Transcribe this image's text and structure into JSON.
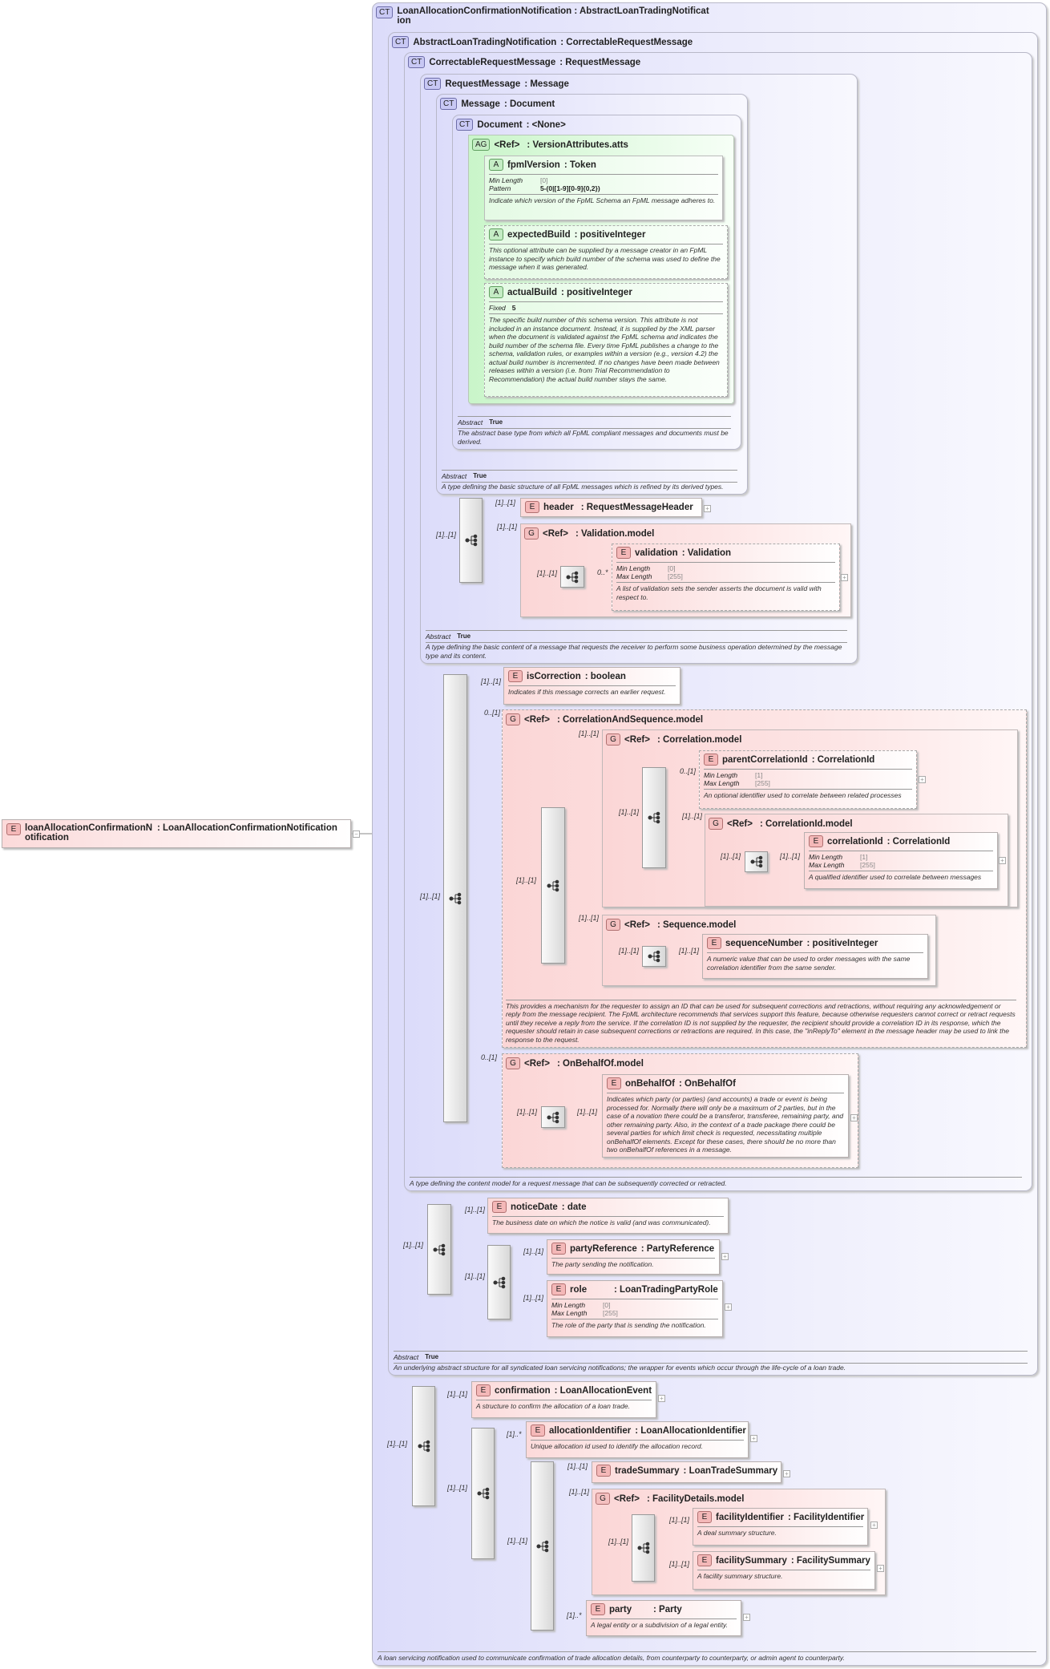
{
  "badges": {
    "ct": "CT",
    "e": "E",
    "g": "G",
    "ag": "AG",
    "a": "A",
    "ref": "<Ref>"
  },
  "root": {
    "name": "loanAllocationConfirmationNotification",
    "type": ": LoanAllocationConfirmationNotification"
  },
  "types": {
    "loanAlloc": {
      "name": "LoanAllocationConfirmationNotification",
      "type": ": AbstractLoanTradingNotification",
      "desc": "A loan servicing notification used to communicate confirmation of trade allocation details, from counterparty to counterparty, or admin agent to counterparty."
    },
    "abstractLoan": {
      "name": "AbstractLoanTradingNotification",
      "type": ": CorrectableRequestMessage",
      "abstract_label": "Abstract",
      "abstract_value": "True",
      "desc": "An underlying abstract structure for all syndicated loan servicing notifications; the wrapper for events which occur through the life-cycle of a loan trade."
    },
    "correctable": {
      "name": "CorrectableRequestMessage",
      "type": ": RequestMessage",
      "desc": "A type defining the content model for a request message that can be subsequently corrected or retracted."
    },
    "request": {
      "name": "RequestMessage",
      "type": ": Message",
      "abstract_label": "Abstract",
      "abstract_value": "True",
      "desc": "A type defining the basic content of a message that requests the receiver to perform some business operation determined by the message type and its content."
    },
    "message": {
      "name": "Message",
      "type": ": Document",
      "abstract_label": "Abstract",
      "abstract_value": "True",
      "desc": "A type defining the basic structure of all FpML messages which is refined by its derived types."
    },
    "document": {
      "name": "Document",
      "type": ": <None>",
      "abstract_label": "Abstract",
      "abstract_value": "True",
      "desc": "The abstract base type from which all FpML compliant messages and documents must be derived."
    }
  },
  "version_atts": {
    "type": ": VersionAttributes.atts",
    "fpmlVersion": {
      "name": "fpmlVersion",
      "type": ": Token",
      "min_label": "Min Length",
      "min": "[0]",
      "pattern_label": "Pattern",
      "pattern": "5-(0|[1-9][0-9]{0,2})",
      "desc": "Indicate which version of the FpML Schema an FpML message adheres to."
    },
    "expectedBuild": {
      "name": "expectedBuild",
      "type": ": positiveInteger",
      "desc": "This optional attribute can be supplied by a message creator in an FpML instance to specify which build number of the schema was used to define the message when it was generated."
    },
    "actualBuild": {
      "name": "actualBuild",
      "type": ": positiveInteger",
      "fixed_label": "Fixed",
      "fixed": "5",
      "desc": "The specific build number of this schema version. This attribute is not included in an instance document. Instead, it is supplied by the XML parser when the document is validated against the FpML schema and indicates the build number of the schema file. Every time FpML publishes a change to the schema, validation rules, or examples within a version (e.g., version 4.2) the actual build number is incremented. If no changes have been made between releases within a version (i.e. from Trial Recommendation to Recommendation) the actual build number stays the same."
    }
  },
  "header": {
    "name": "header",
    "type": ": RequestMessageHeader",
    "card": "[1]..[1]"
  },
  "validation_model": {
    "type": ": Validation.model",
    "card": "[1]..[1]",
    "seq_card": "[1]..[1]",
    "inner_card": "0..*"
  },
  "validation": {
    "name": "validation",
    "type": ": Validation",
    "min_label": "Min Length",
    "min": "[0]",
    "max_label": "Max Length",
    "max": "[255]",
    "desc": "A list of validation sets the sender asserts the document is valid with respect to."
  },
  "request_seq_card": "[1]..[1]",
  "isCorrection": {
    "name": "isCorrection",
    "type": ": boolean",
    "card": "[1]..[1]",
    "desc": "Indicates if this message corrects an earlier request."
  },
  "corr_seq": {
    "type": ": CorrelationAndSequence.model",
    "card": "0..[1]",
    "seq_card": "[1]..[1]",
    "desc": "This provides a mechanism for the requester to assign an ID that can be used for subsequent corrections and retractions, without requiring any acknowledgement or reply from the message recipient. The FpML architecture recommends that services support this feature, because otherwise requesters cannot correct or retract requests until they receive a reply from the service. If the correlation ID is not supplied by the requester, the recipient should provide a correlation ID in its response, which the requester should retain in case subsequent corrections or retractions are required. In this case, the \"inReplyTo\" element in the message header may be used to link the response to the request."
  },
  "correlation_model": {
    "type": ": Correlation.model",
    "card": "[1]..[1]",
    "seq_card": "[1]..[1]"
  },
  "parentCorrelationId": {
    "name": "parentCorrelationId",
    "type": ": CorrelationId",
    "card": "0..[1]",
    "min_label": "Min Length",
    "min": "[1]",
    "max_label": "Max Length",
    "max": "[255]",
    "desc": "An optional identifier used to correlate between related processes"
  },
  "correlationId_model": {
    "type": ": CorrelationId.model",
    "card": "[1]..[1]",
    "seq_card": "[1]..[1]"
  },
  "correlationId": {
    "name": "correlationId",
    "type": ": CorrelationId",
    "card": "[1]..[1]",
    "min_label": "Min Length",
    "min": "[1]",
    "max_label": "Max Length",
    "max": "[255]",
    "desc": "A qualified identifier used to correlate between messages"
  },
  "sequence_model": {
    "type": ": Sequence.model",
    "card": "[1]..[1]",
    "seq_card": "[1]..[1]"
  },
  "sequenceNumber": {
    "name": "sequenceNumber",
    "type": ": positiveInteger",
    "card": "[1]..[1]",
    "desc": "A numeric value that can be used to order messages with the same correlation identifier from the same sender."
  },
  "onBehalf_model": {
    "type": ": OnBehalfOf.model",
    "card": "0..[1]",
    "seq_card": "[1]..[1]"
  },
  "onBehalfOf": {
    "name": "onBehalfOf",
    "type": ": OnBehalfOf",
    "card": "[1]..[1]",
    "desc": "Indicates which party (or parties) (and accounts) a trade or event is being processed for. Normally there will only be a maximum of 2 parties, but in the case of a novation there could be a transferor, transferee, remaining party, and other remaining party. Also, in the context of a trade package there could be several parties for which limit check is requested, necessitating multiple onBehalfOf elements. Except for these cases, there should be no more than two onBehalfOf references in a message."
  },
  "correctable_seq_card": "[1]..[1]",
  "noticeDate": {
    "name": "noticeDate",
    "type": ": date",
    "card": "[1]..[1]",
    "desc": "The business date on which the notice is valid (and was communicated)."
  },
  "party_seq_card": "[1]..[1]",
  "partyReference": {
    "name": "partyReference",
    "type": ": PartyReference",
    "card": "[1]..[1]",
    "desc": "The party sending the notification."
  },
  "role": {
    "name": "role",
    "type": ": LoanTradingPartyRole",
    "card": "[1]..[1]",
    "min_label": "Min Length",
    "min": "[0]",
    "max_label": "Max Length",
    "max": "[255]",
    "desc": "The role of the party that is sending the notification."
  },
  "abstract_seq_card": "[1]..[1]",
  "outer_seq_card": "[1]..[1]",
  "confirmation": {
    "name": "confirmation",
    "type": ": LoanAllocationEvent",
    "card": "[1]..[1]",
    "desc": "A structure to confirm the allocation of a loan trade."
  },
  "seq2_card": "[1]..[1]",
  "allocationIdentifier": {
    "name": "allocationIdentifier",
    "type": ": LoanAllocationIdentifier",
    "card": "[1]..*",
    "desc": "Unique allocation id used to identify the allocation record."
  },
  "seq3_card": "[1]..[1]",
  "tradeSummary": {
    "name": "tradeSummary",
    "type": ": LoanTradeSummary",
    "card": "[1]..[1]"
  },
  "facility_model": {
    "type": ": FacilityDetails.model",
    "card": "[1]..[1]",
    "seq_card": "[1]..[1]"
  },
  "facilityIdentifier": {
    "name": "facilityIdentifier",
    "type": ": FacilityIdentifier",
    "card": "[1]..[1]",
    "desc": "A deal summary structure."
  },
  "facilitySummary": {
    "name": "facilitySummary",
    "type": ": FacilitySummary",
    "card": "[1]..[1]",
    "desc": "A facility summary structure."
  },
  "party": {
    "name": "party",
    "type": ": Party",
    "card": "[1]..*",
    "desc": "A legal entity or a subdivision of a legal entity."
  },
  "colors": {
    "complex_type": "#dcdcfa",
    "element": "#fcdada",
    "attribute_group": "#c9f5c9"
  }
}
